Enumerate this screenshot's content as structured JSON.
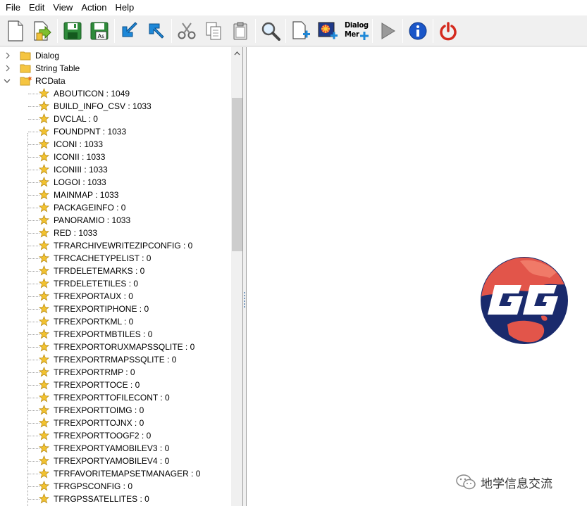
{
  "menu": [
    "File",
    "Edit",
    "View",
    "Action",
    "Help"
  ],
  "toolbar": {
    "dialog_menu_label_1": "Dialog",
    "dialog_menu_label_2": "Mer"
  },
  "tree": {
    "top_nodes": [
      {
        "label": "Dialog",
        "expanded": false
      },
      {
        "label": "String Table",
        "expanded": false
      },
      {
        "label": "RCData",
        "expanded": true
      }
    ],
    "rcdata_items": [
      "ABOUTICON : 1049",
      "BUILD_INFO_CSV : 1033",
      "DVCLAL : 0",
      "FOUNDPNT : 1033",
      "ICONI : 1033",
      "ICONII : 1033",
      "ICONIII : 1033",
      "LOGOI : 1033",
      "MAINMAP : 1033",
      "PACKAGEINFO : 0",
      "PANORAMIO : 1033",
      "RED : 1033",
      "TFRARCHIVEWRITEZIPCONFIG : 0",
      "TFRCACHETYPELIST : 0",
      "TFRDELETEMARKS : 0",
      "TFRDELETETILES : 0",
      "TFREXPORTAUX : 0",
      "TFREXPORTIPHONE : 0",
      "TFREXPORTKML : 0",
      "TFREXPORTMBTILES : 0",
      "TFREXPORTORUXMAPSSQLITE : 0",
      "TFREXPORTRMAPSSQLITE : 0",
      "TFREXPORTRMP : 0",
      "TFREXPORTTOCE : 0",
      "TFREXPORTTOFILECONT : 0",
      "TFREXPORTTOIMG : 0",
      "TFREXPORTTOJNX : 0",
      "TFREXPORTTOOGF2 : 0",
      "TFREXPORTYAMOBILEV3 : 0",
      "TFREXPORTYAMOBILEV4 : 0",
      "TFRFAVORITEMAPSETMANAGER : 0",
      "TFRGPSCONFIG : 0",
      "TFRGPSSATELLITES : 0"
    ]
  },
  "watermark": {
    "text": "地学信息交流"
  },
  "colors": {
    "folder": "#f5c542",
    "star": "#f2c230",
    "logo_ocean": "#1a2a6c",
    "logo_land": "#e2554a",
    "logo_letters": "#ffffff"
  }
}
